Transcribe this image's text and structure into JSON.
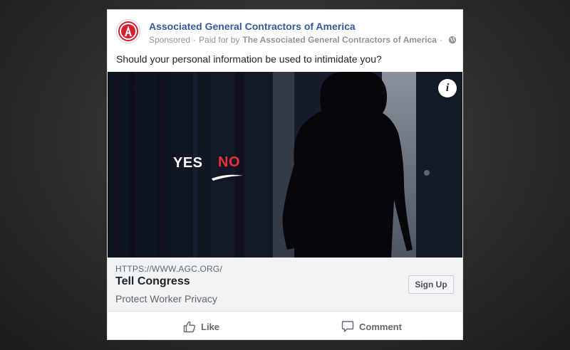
{
  "post": {
    "page_name": "Associated General Contractors of America",
    "sponsored": "Sponsored",
    "separator": "·",
    "paid_for_by_label": "Paid for by",
    "paid_for_by": "The Associated General Contractors of America",
    "caption": "Should your personal information be used to intimidate you?"
  },
  "image": {
    "yes_text": "YES",
    "no_text": "NO",
    "info_label": "i"
  },
  "link": {
    "domain": "HTTPS://WWW.AGC.ORG/",
    "title": "Tell Congress",
    "description": "Protect Worker Privacy",
    "cta_label": "Sign Up"
  },
  "actions": {
    "like_label": "Like",
    "comment_label": "Comment"
  },
  "icons": [
    "agc-logo-icon",
    "globe-icon",
    "info-icon",
    "like-icon",
    "comment-icon"
  ],
  "colors": {
    "page_name": "#385898",
    "no_text": "#e8303a",
    "logo_red": "#d3202f"
  }
}
